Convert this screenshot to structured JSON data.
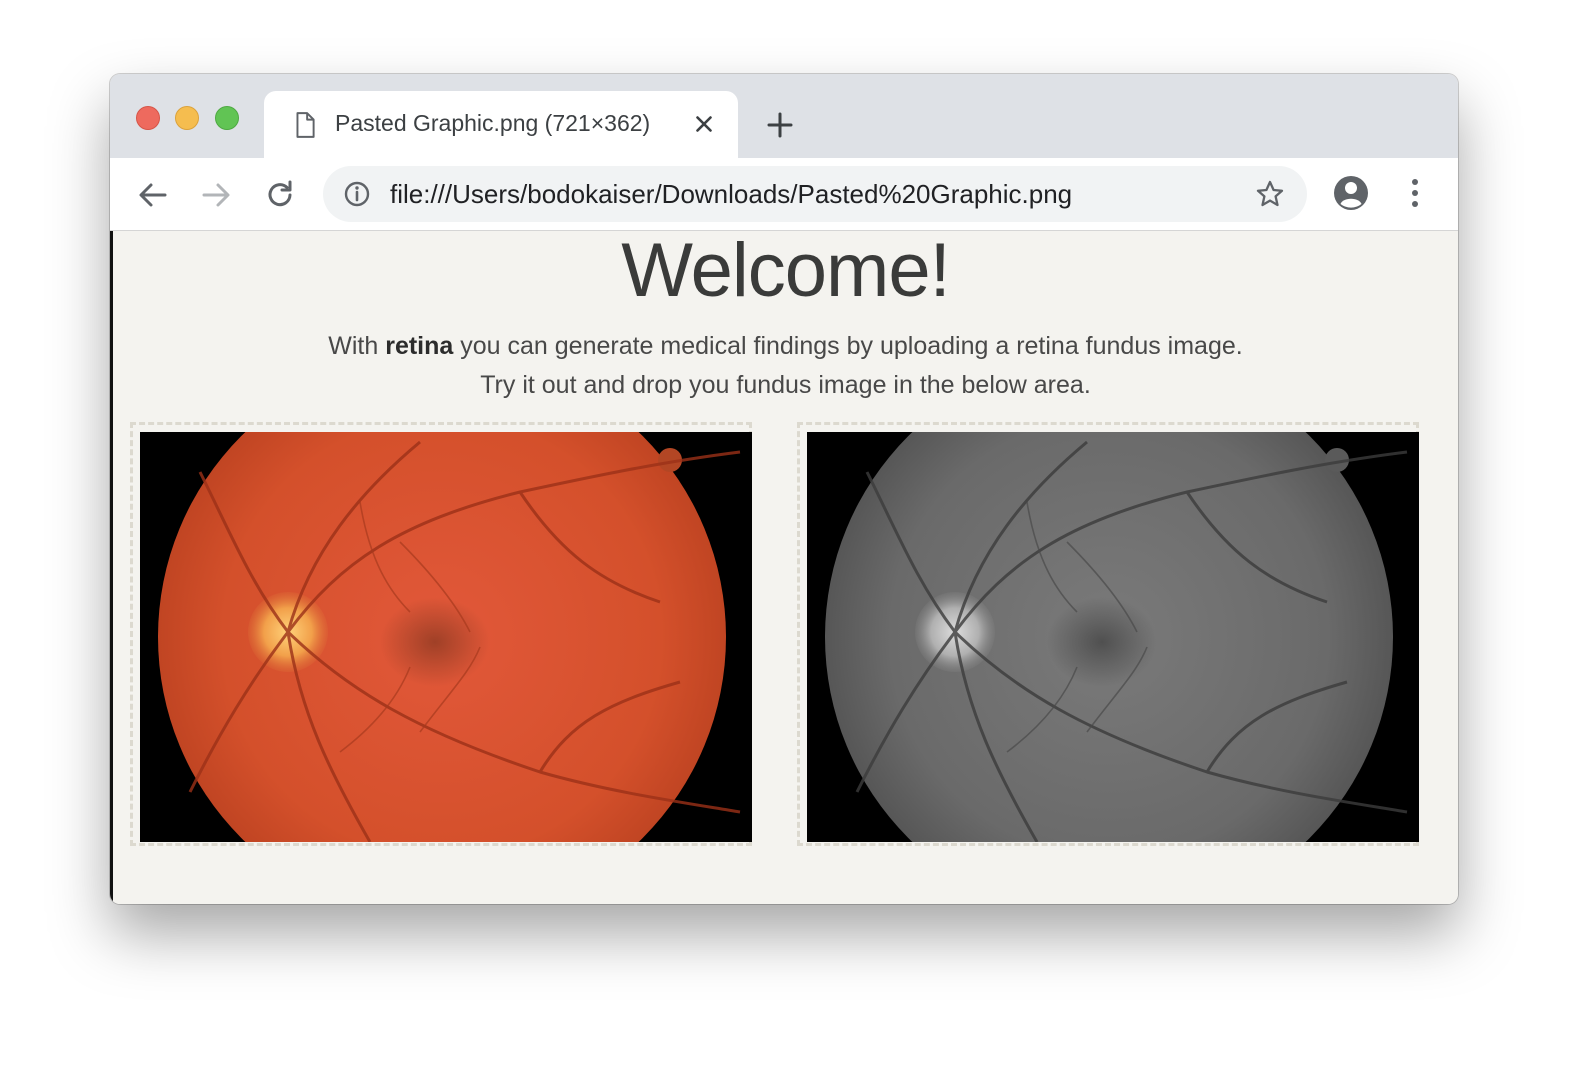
{
  "browser": {
    "tab": {
      "title": "Pasted Graphic.png (721×362)",
      "icon": "file-icon",
      "close_icon": "close-icon"
    },
    "new_tab_icon": "plus-icon",
    "toolbar": {
      "back_icon": "back-arrow-icon",
      "forward_icon": "forward-arrow-icon",
      "reload_icon": "reload-icon",
      "site_info_icon": "info-icon",
      "url": "file:///Users/bodokaiser/Downloads/Pasted%20Graphic.png",
      "bookmark_icon": "star-icon",
      "profile_icon": "account-circle-icon",
      "menu_icon": "more-vert-icon"
    }
  },
  "page": {
    "heading": "Welcome!",
    "intro_prefix": "With ",
    "intro_bold": "retina",
    "intro_suffix": " you can generate medical findings by uploading a retina fundus image.",
    "intro_line2": "Try it out and drop you fundus image in the below area.",
    "dropzones": [
      {
        "image": "color retina fundus photograph"
      },
      {
        "image": "grayscale retina fundus photograph"
      }
    ]
  },
  "colors": {
    "tabstrip": "#dee1e6",
    "page_background": "#f4f3ef",
    "fundus_color": "#d9522b",
    "fundus_gray": "#6e6e6e"
  }
}
